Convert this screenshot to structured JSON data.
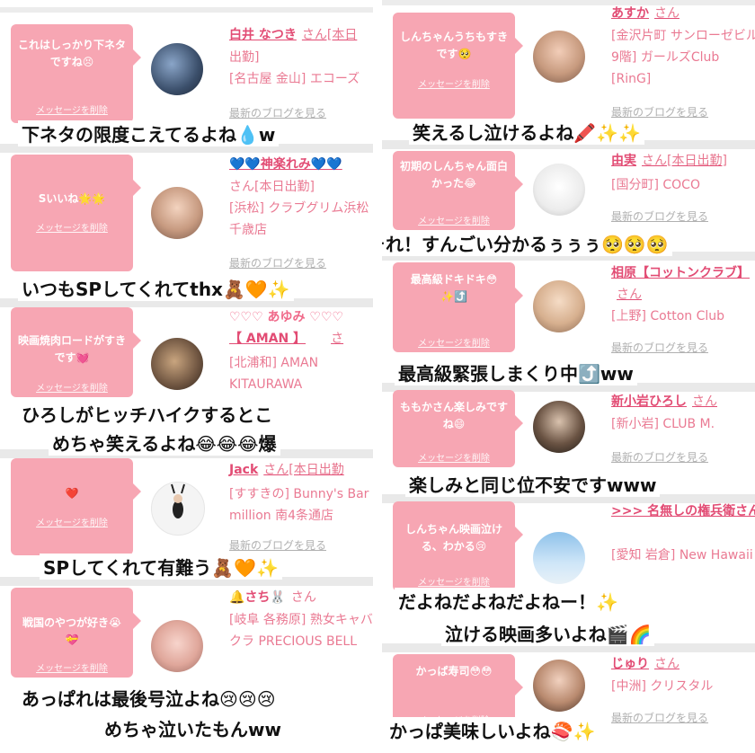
{
  "common": {
    "delete_label": "メッセージを削除",
    "blog_link": "最新のブログを見る",
    "san": "さん"
  },
  "left": [
    {
      "message": "これはしっかり下ネタですね😣",
      "name": "白井 なつき",
      "san": "さん[本日",
      "info1": "出勤]",
      "info2": "[名古屋 金山] エコーズ"
    },
    {
      "message": "Sいいね🌟🌟",
      "name": "💙💙神楽れみ💙💙",
      "san": "",
      "info1": "さん[本日出勤]",
      "info2": "[浜松] クラブグリム浜松千歳店"
    },
    {
      "message": "映画焼肉ロードがすきです💓",
      "name": "♡♡♡ あゆみ ♡♡♡",
      "name2": "【 AMAN 】",
      "san": "さ",
      "info1": "[北浦和] AMAN KITAURAWA",
      "info2": ""
    },
    {
      "message": "❤️",
      "name": "Jack",
      "san": "さん[本日出勤",
      "info1": "[すすきの] Bunny's Bar million 南4条通店",
      "info2": ""
    },
    {
      "message": "戦国のやつが好き😭💝",
      "name": "🔔さち🐰",
      "san": "さん",
      "info1": "[岐阜 各務原] 熟女キャバクラ PRECIOUS BELL",
      "info2": ""
    }
  ],
  "right": [
    {
      "message": "しんちゃんうちもすきです🥺",
      "name": "あすか",
      "san": "さん",
      "info1": "[金沢片町 サンローゼビル9階] ガールズClub [RinG]",
      "info2": ""
    },
    {
      "message": "初期のしんちゃん面白かった😂",
      "name": "由実",
      "san": "さん[本日出勤]",
      "info1": "[国分町] COCO",
      "info2": ""
    },
    {
      "message": "最高級ドキドキ😳✨⤴️",
      "name": "相原【コットンクラブ】",
      "san": "さん",
      "info1": "[上野] Cotton Club",
      "info2": ""
    },
    {
      "message": "ももかさん楽しみですね😄",
      "name": "新小岩ひろし",
      "san": "さん",
      "info1": "[新小岩] CLUB M.",
      "info2": ""
    },
    {
      "message": "しんちゃん映画泣ける、わかる😢",
      "name": ">>> 名無しの権兵衛さん🐟",
      "san": "さん",
      "info1": "[愛知 岩倉] New Hawaii",
      "info2": ""
    },
    {
      "message": "かっぱ寿司😳😳",
      "name": "じゅり",
      "san": "さん",
      "info1": "[中洲] クリスタル",
      "info2": ""
    }
  ],
  "captions": {
    "c1": "下ネタの限度こえてるよね💧w",
    "c2": "いつもSPしてくれてthx🧸🧡✨",
    "c3": "ひろしがヒッチハイクするとこ",
    "c4": "めちゃ笑えるよね😂😂😂爆",
    "c5": "SPしてくれて有難う🧸🧡✨",
    "c6": "あっぱれは最後号泣よね😢😢😢",
    "c7": "めちゃ泣いたもんww",
    "r1": "笑えるし泣けるよね🖍️✨✨",
    "r2": "それ！すんごい分かるぅぅぅ🥺🥺🥺",
    "r3": "最高級緊張しまくり中⤴️ww",
    "r4": "楽しみと同じ位不安ですwww",
    "r5": "だよねだよねだよねー！✨",
    "r6": "泣ける映画多いよね🎬🌈",
    "r7": "かっぱ美味しいよね🍣✨"
  },
  "colors": {
    "bubble": "#f7a6b3",
    "name": "#e24c74",
    "info": "#ea7a93",
    "separator": "#e9e9e9"
  }
}
